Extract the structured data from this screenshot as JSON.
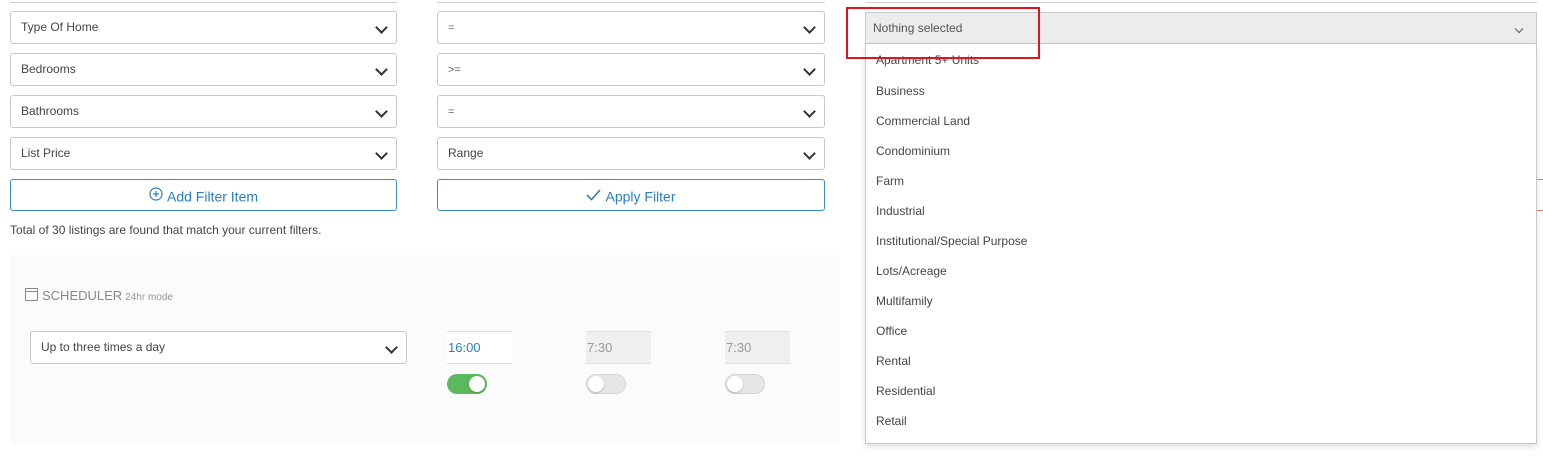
{
  "filters": {
    "rows": [
      {
        "field": "Type Of Home",
        "operator": "="
      },
      {
        "field": "Bedrooms",
        "operator": ">="
      },
      {
        "field": "Bathrooms",
        "operator": "="
      },
      {
        "field": "List Price",
        "operator": "Range"
      }
    ],
    "add_button_label": "Add Filter Item",
    "apply_button_label": "Apply Filter",
    "result_text": "Total of 30 listings are found that match your current filters."
  },
  "scheduler": {
    "title": "SCHEDULER",
    "mode_label": "24hr mode",
    "frequency": "Up to three times a day",
    "slots": [
      {
        "time": "16:00",
        "enabled": true
      },
      {
        "time": "7:30",
        "enabled": false
      },
      {
        "time": "7:30",
        "enabled": false
      }
    ]
  },
  "value_dropdown": {
    "selected_text": "Nothing selected",
    "options": [
      "Apartment 5+ Units",
      "Business",
      "Commercial Land",
      "Condominium",
      "Farm",
      "Industrial",
      "Institutional/Special Purpose",
      "Lots/Acreage",
      "Multifamily",
      "Office",
      "Rental",
      "Residential",
      "Retail"
    ]
  },
  "colors": {
    "accent": "#2a7ec0",
    "toggle_on": "#5cb85c",
    "highlight": "#e0141c"
  }
}
